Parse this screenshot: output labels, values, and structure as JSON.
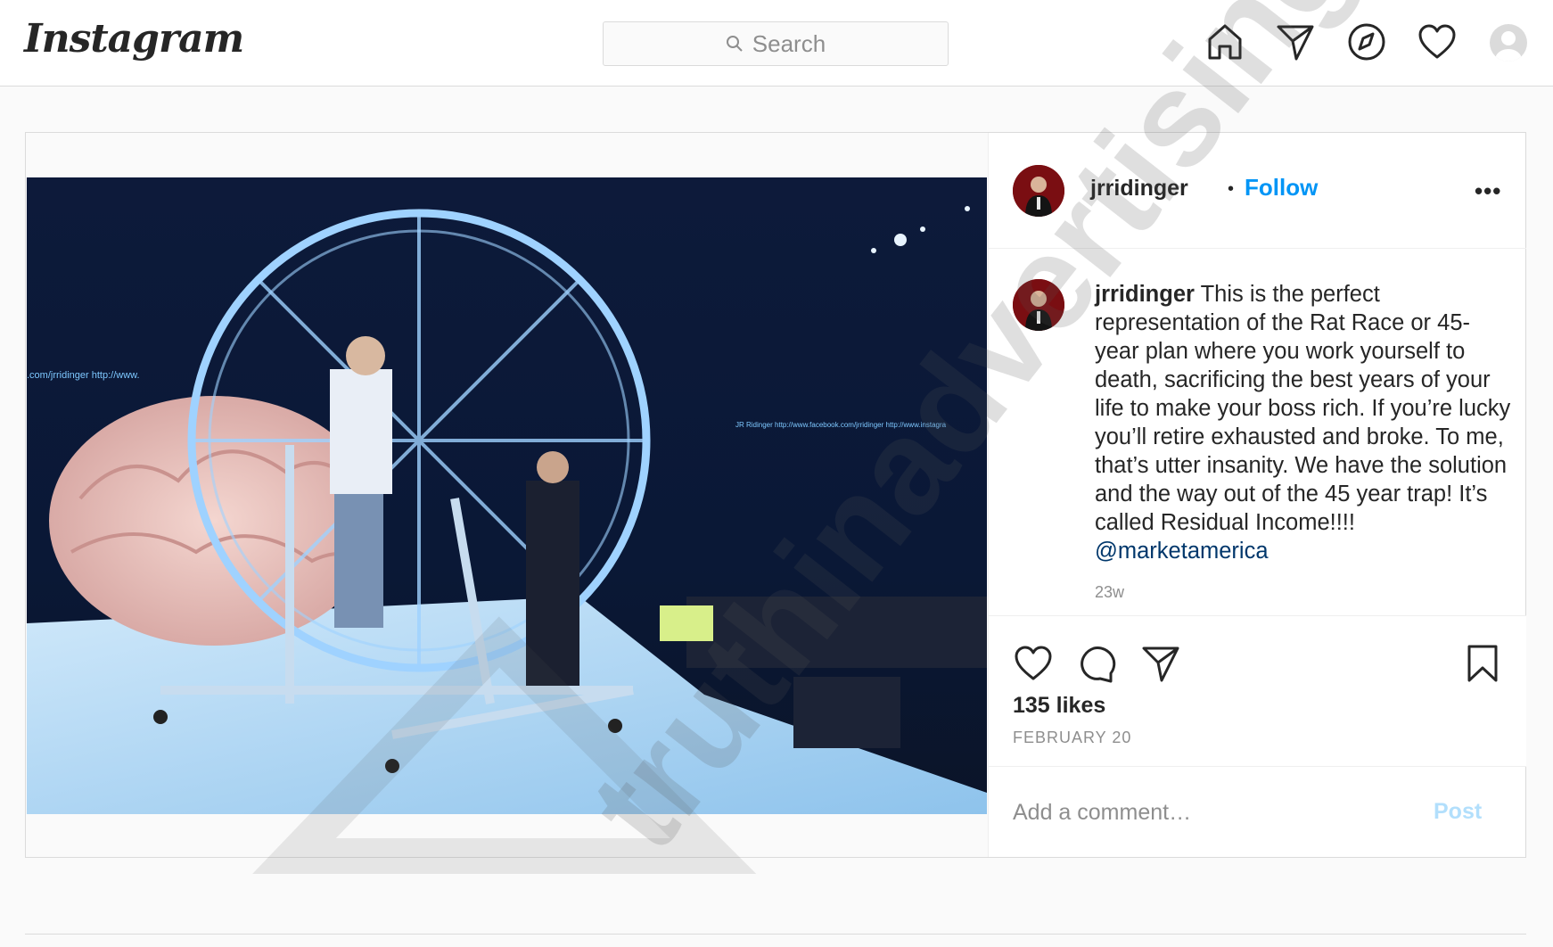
{
  "header": {
    "logo_text": "Instagram",
    "search_placeholder": "Search",
    "icons": [
      "home-icon",
      "direct-icon",
      "explore-icon",
      "activity-icon",
      "profile-avatar"
    ]
  },
  "post": {
    "username": "jrridinger",
    "follow_label": "Follow",
    "separator": "•",
    "more_label": "•••",
    "caption": {
      "username": "jrridinger",
      "text": "This is the perfect representation of the Rat Race or 45-year plan where you work yourself to death, sacrificing the best years of your life to make your boss rich. If you’re lucky you’ll retire exhausted and broke. To me, that’s utter insanity. We have the solution and the way out of the 45 year trap! It’s called Residual Income!!!!",
      "mention": "@marketamerica",
      "age": "23w"
    },
    "likes": "135 likes",
    "date": "FEBRUARY 20",
    "comment_placeholder": "Add a comment…",
    "post_label": "Post"
  },
  "photo_text": {
    "banner_left": ".com/jrridinger  http://www.",
    "banner_right": "JR Ridinger  http://www.facebook.com/jrridinger  http://www.instagra"
  },
  "watermark": "truthinadvertising.org",
  "colors": {
    "accent": "#0095f6",
    "post_disabled": "#b2dffc",
    "mention": "#00376b",
    "border": "#dbdbdb"
  }
}
